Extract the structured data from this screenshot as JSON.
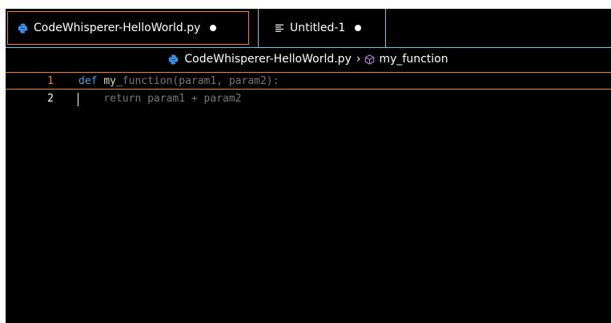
{
  "tabs": [
    {
      "label": "CodeWhisperer-HelloWorld.py",
      "icon": "python-icon",
      "active": true,
      "dirty": true
    },
    {
      "label": "Untitled-1",
      "icon": "text-file-icon",
      "active": false,
      "dirty": true
    }
  ],
  "breadcrumb": {
    "file": "CodeWhisperer-HelloWorld.py",
    "separator": "›",
    "symbol": "my_function",
    "symbol_icon": "cube-icon"
  },
  "editor": {
    "lines": [
      {
        "number": "1",
        "keyword": "def",
        "function_name": "my_",
        "rest": "function(param1, param2):"
      },
      {
        "number": "2",
        "suggestion": "    return param1 + param2"
      }
    ]
  },
  "colors": {
    "accent_orange": "#f38518",
    "border_blue": "#6fc3df",
    "python_blue": "#3d8ee8",
    "keyword": "#569cd6",
    "ghost_text": "#777777"
  }
}
